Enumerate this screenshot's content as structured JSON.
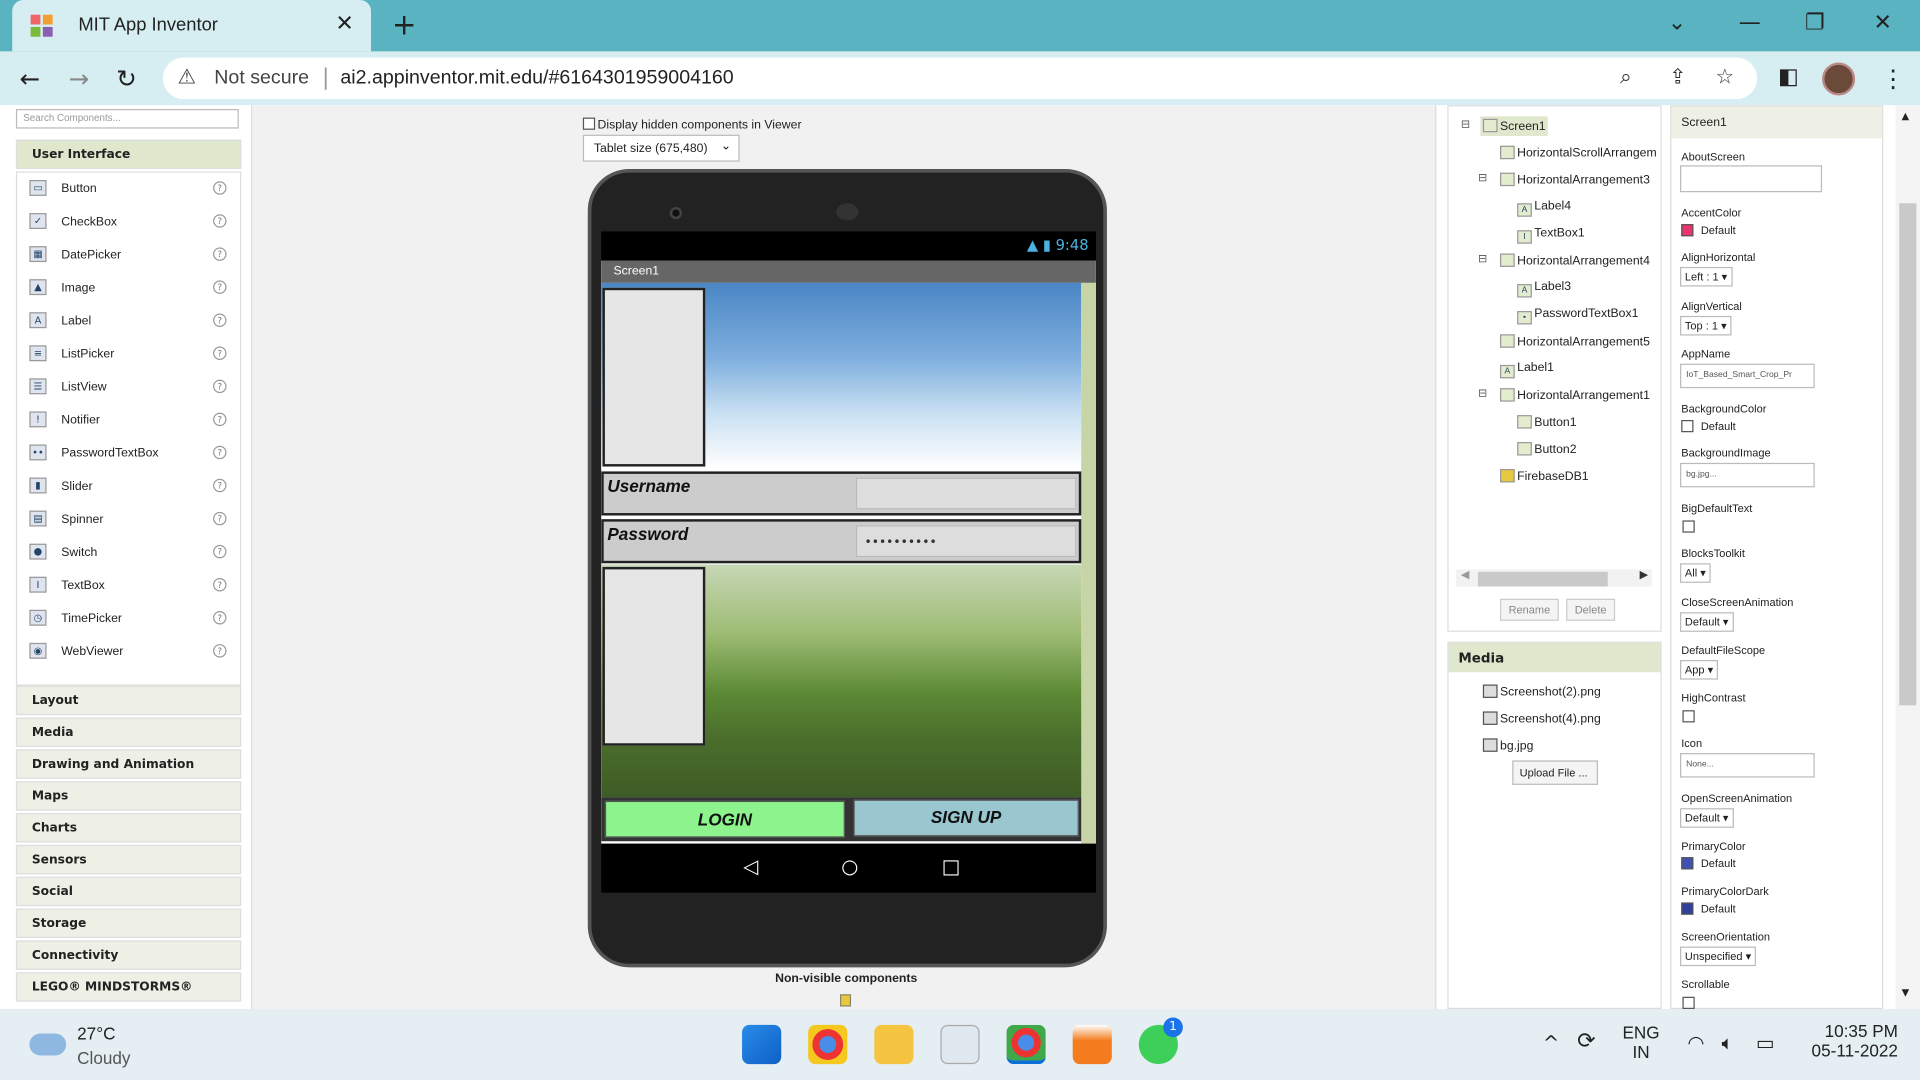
{
  "browser": {
    "tab_title": "MIT App Inventor",
    "close_label": "✕",
    "new_tab_label": "+",
    "security_label": "Not secure",
    "url": "ai2.appinventor.mit.edu/#6164301959004160"
  },
  "palette": {
    "search_placeholder": "Search Components...",
    "active_category": "User Interface",
    "components": [
      "Button",
      "CheckBox",
      "DatePicker",
      "Image",
      "Label",
      "ListPicker",
      "ListView",
      "Notifier",
      "PasswordTextBox",
      "Slider",
      "Spinner",
      "Switch",
      "TextBox",
      "TimePicker",
      "WebViewer"
    ],
    "categories": [
      "Layout",
      "Media",
      "Drawing and Animation",
      "Maps",
      "Charts",
      "Sensors",
      "Social",
      "Storage",
      "Connectivity",
      "LEGO® MINDSTORMS®"
    ]
  },
  "viewer": {
    "hidden_checkbox_label": "Display hidden components in Viewer",
    "size_select": "Tablet size (675,480)",
    "status_time": "9:48",
    "screen_title": "Screen1",
    "username_label": "Username",
    "password_label": "Password",
    "password_value": "••••••••••",
    "login_label": "LOGIN",
    "signup_label": "SIGN UP",
    "nonvisible_label": "Non-visible components"
  },
  "tree": {
    "nodes": [
      "Screen1",
      "HorizontalScrollArrangem",
      "HorizontalArrangement3",
      "Label4",
      "TextBox1",
      "HorizontalArrangement4",
      "Label3",
      "PasswordTextBox1",
      "HorizontalArrangement5",
      "Label1",
      "HorizontalArrangement1",
      "Button1",
      "Button2",
      "FirebaseDB1"
    ],
    "rename_label": "Rename",
    "delete_label": "Delete"
  },
  "media": {
    "title": "Media",
    "files": [
      "Screenshot(2).png",
      "Screenshot(4).png",
      "bg.jpg"
    ],
    "upload_label": "Upload File ..."
  },
  "properties": {
    "title": "Screen1",
    "about_label": "AboutScreen",
    "accent_label": "AccentColor",
    "accent_value": "Default",
    "accent_color": "#e8336d",
    "alignh_label": "AlignHorizontal",
    "alignh_value": "Left : 1",
    "alignv_label": "AlignVertical",
    "alignv_value": "Top : 1",
    "appname_label": "AppName",
    "appname_value": "IoT_Based_Smart_Crop_Pr",
    "bgcolor_label": "BackgroundColor",
    "bgcolor_value": "Default",
    "bgimage_label": "BackgroundImage",
    "bgimage_value": "bg.jpg...",
    "bigtext_label": "BigDefaultText",
    "blocks_label": "BlocksToolkit",
    "blocks_value": "All",
    "closeanim_label": "CloseScreenAnimation",
    "closeanim_value": "Default",
    "filescope_label": "DefaultFileScope",
    "filescope_value": "App",
    "highcontrast_label": "HighContrast",
    "icon_label": "Icon",
    "icon_value": "None...",
    "openanim_label": "OpenScreenAnimation",
    "openanim_value": "Default",
    "primary_label": "PrimaryColor",
    "primary_value": "Default",
    "primary_color": "#3f51b5",
    "primarydark_label": "PrimaryColorDark",
    "primarydark_value": "Default",
    "primarydark_color": "#303f9f",
    "orient_label": "ScreenOrientation",
    "orient_value": "Unspecified",
    "scrollable_label": "Scrollable"
  },
  "taskbar": {
    "temp": "27°C",
    "condition": "Cloudy",
    "lang_top": "ENG",
    "lang_bottom": "IN",
    "time": "10:35 PM",
    "date": "05-11-2022",
    "whatsapp_badge": "1"
  }
}
